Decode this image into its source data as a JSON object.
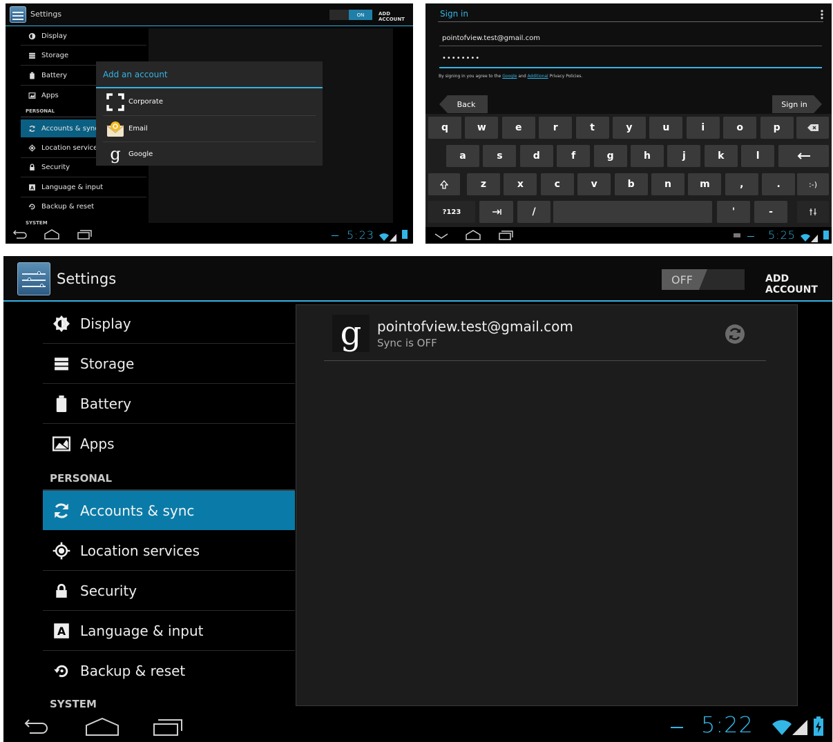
{
  "panel1": {
    "title": "Settings",
    "toggle": "ON",
    "add_account": "ADD ACCOUNT",
    "menu": [
      "Display",
      "Storage",
      "Battery",
      "Apps"
    ],
    "section_personal": "PERSONAL",
    "menu2": [
      "Accounts & sync",
      "Location services",
      "Security",
      "Language & input",
      "Backup & reset"
    ],
    "section_system": "SYSTEM",
    "dialog": {
      "title": "Add an account",
      "items": [
        "Corporate",
        "Email",
        "Google"
      ]
    },
    "time": "5:23"
  },
  "panel2": {
    "title": "Sign in",
    "email": "pointofview.test@gmail.com",
    "password": "••••••••",
    "legal": {
      "prefix": "By signing in you agree to the ",
      "link1": "Google",
      "mid": " and ",
      "link2": "Additional",
      "suffix": " Privacy Policies."
    },
    "back": "Back",
    "signin": "Sign in",
    "row1": [
      "q",
      "w",
      "e",
      "r",
      "t",
      "y",
      "u",
      "i",
      "o",
      "p"
    ],
    "row2": [
      "a",
      "s",
      "d",
      "f",
      "g",
      "h",
      "j",
      "k",
      "l"
    ],
    "row3": [
      "z",
      "x",
      "c",
      "v",
      "b",
      "n",
      "m",
      ",",
      "."
    ],
    "smiley": ":-)",
    "num": "?123",
    "slash": "/",
    "apos": "'",
    "dash": "-",
    "time": "5:25"
  },
  "panel3": {
    "title": "Settings",
    "toggle": "OFF",
    "add_account": "ADD ACCOUNT",
    "menu": [
      "Display",
      "Storage",
      "Battery",
      "Apps"
    ],
    "section_personal": "PERSONAL",
    "menu2": [
      "Accounts & sync",
      "Location services",
      "Security",
      "Language & input",
      "Backup & reset"
    ],
    "section_system": "SYSTEM",
    "account_email": "pointofview.test@gmail.com",
    "account_status": "Sync is OFF",
    "time": "5:22"
  },
  "colors": {
    "accent": "#33b5e5",
    "selected": "#0a7ba8"
  }
}
